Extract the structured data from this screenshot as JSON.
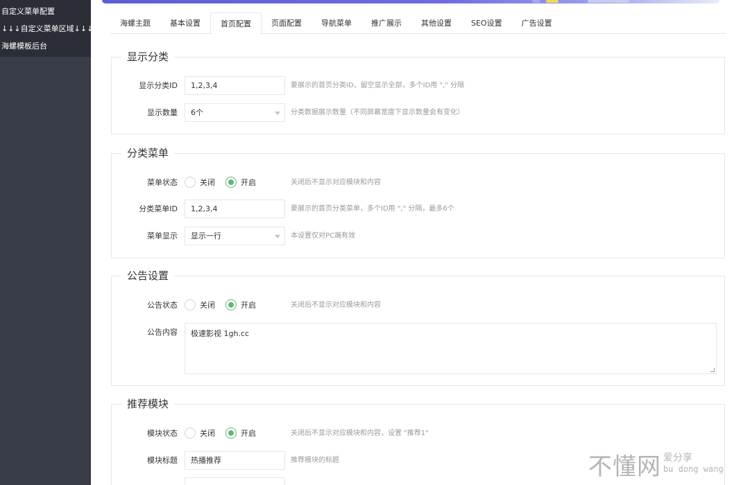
{
  "sidebar": {
    "items": [
      {
        "label": "自定义菜单配置"
      },
      {
        "label": "↓↓↓自定义菜单区域↓↓↓"
      },
      {
        "label": "海螺模板后台"
      }
    ]
  },
  "tabs": [
    {
      "label": "海螺主题",
      "active": false
    },
    {
      "label": "基本设置",
      "active": false
    },
    {
      "label": "首页配置",
      "active": true
    },
    {
      "label": "页面配置",
      "active": false
    },
    {
      "label": "导航菜单",
      "active": false
    },
    {
      "label": "推广展示",
      "active": false
    },
    {
      "label": "其他设置",
      "active": false
    },
    {
      "label": "SEO设置",
      "active": false
    },
    {
      "label": "广告设置",
      "active": false
    }
  ],
  "sections": {
    "category": {
      "title": "显示分类",
      "id_label": "显示分类ID",
      "id_value": "1,2,3,4",
      "id_hint": "要展示的首页分类ID，留空显示全部，多个ID用 \",\" 分隔",
      "count_label": "显示数量",
      "count_value": "6个",
      "count_hint": "分类数据展示数量（不同屏幕宽度下显示数量会有变化）"
    },
    "menu": {
      "title": "分类菜单",
      "status_label": "菜单状态",
      "off_label": "关闭",
      "on_label": "开启",
      "status_hint": "关闭后不显示对应模块和内容",
      "id_label": "分类菜单ID",
      "id_value": "1,2,3,4",
      "id_hint": "要展示的首页分类菜单，多个ID用 \",\" 分隔，最多6个",
      "display_label": "菜单显示",
      "display_value": "显示一行",
      "display_hint": "本设置仅对PC端有效"
    },
    "notice": {
      "title": "公告设置",
      "status_label": "公告状态",
      "off_label": "关闭",
      "on_label": "开启",
      "status_hint": "关闭后不显示对应模块和内容",
      "content_label": "公告内容",
      "content_value": "极速影视 1gh.cc"
    },
    "recommend": {
      "title": "推荐模块",
      "status_label": "模块状态",
      "off_label": "关闭",
      "on_label": "开启",
      "status_hint": "关闭后不显示对应模块和内容，设置 \"推荐1\"",
      "title_label": "模块标题",
      "title_value": "热播推荐",
      "title_hint": "推荐模块的标题"
    }
  },
  "watermark": {
    "big": "不懂网",
    "small": "爱分享",
    "pinyin": "bu dong wang"
  },
  "colors": {
    "sidebar": "#393d49",
    "sidebar_top": "#2b2e37",
    "radio_on": "#5fb878",
    "strip": "#5b5fd6"
  }
}
